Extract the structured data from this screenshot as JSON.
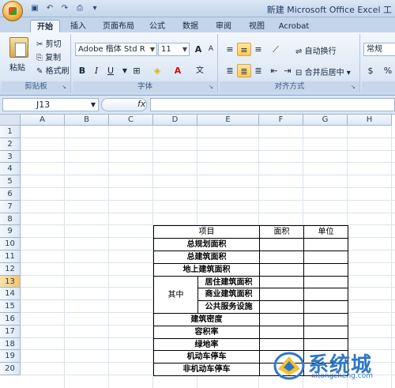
{
  "window": {
    "title": "新建 Microsoft Office Excel 工"
  },
  "ribbon_tabs": [
    {
      "label": "开始",
      "active": true
    },
    {
      "label": "插入",
      "active": false
    },
    {
      "label": "页面布局",
      "active": false
    },
    {
      "label": "公式",
      "active": false
    },
    {
      "label": "数据",
      "active": false
    },
    {
      "label": "审阅",
      "active": false
    },
    {
      "label": "视图",
      "active": false
    },
    {
      "label": "Acrobat",
      "active": false
    }
  ],
  "clipboard": {
    "paste": "粘贴",
    "cut": "剪切",
    "copy": "复制",
    "format_painter": "格式刷",
    "group_label": "剪贴板"
  },
  "font": {
    "name": "Adobe 楷体 Std R",
    "size": "11",
    "group_label": "字体",
    "bold": "B",
    "italic": "I",
    "underline": "U",
    "grow": "A",
    "shrink": "A",
    "phonetic": "文"
  },
  "alignment": {
    "wrap_text": "自动换行",
    "merge_center": "合并后居中",
    "group_label": "对齐方式"
  },
  "number": {
    "format": "常规",
    "percent": "%"
  },
  "formula_bar": {
    "cell_ref": "J13",
    "fx": "fx",
    "content": ""
  },
  "columns": [
    "A",
    "B",
    "C",
    "D",
    "E",
    "F",
    "G",
    "H"
  ],
  "rows": [
    "1",
    "2",
    "3",
    "4",
    "5",
    "6",
    "7",
    "8",
    "9",
    "10",
    "11",
    "12",
    "13",
    "14",
    "15",
    "16",
    "17",
    "18",
    "19",
    "20"
  ],
  "selected": {
    "col": "J",
    "row": "13"
  },
  "table": {
    "header": {
      "item": "项目",
      "area": "面积",
      "unit": "单位"
    },
    "rows": [
      {
        "item": "总规划面积"
      },
      {
        "item": "总建筑面积"
      },
      {
        "item": "地上建筑面积"
      },
      {
        "group": "其中",
        "item": "居住建筑面积"
      },
      {
        "item": "商业建筑面积"
      },
      {
        "item": "公共服务设施"
      },
      {
        "item": "建筑密度"
      },
      {
        "item": "容积率"
      },
      {
        "item": "绿地率"
      },
      {
        "item": "机动车停车"
      },
      {
        "item": "非机动车停车"
      }
    ]
  },
  "watermark": {
    "brand": "系统城",
    "url": "xitongcheng.com"
  },
  "colors": {
    "accent": "#2e77c6",
    "ribbon": "#dde8f5",
    "selection": "#f7c46a"
  }
}
